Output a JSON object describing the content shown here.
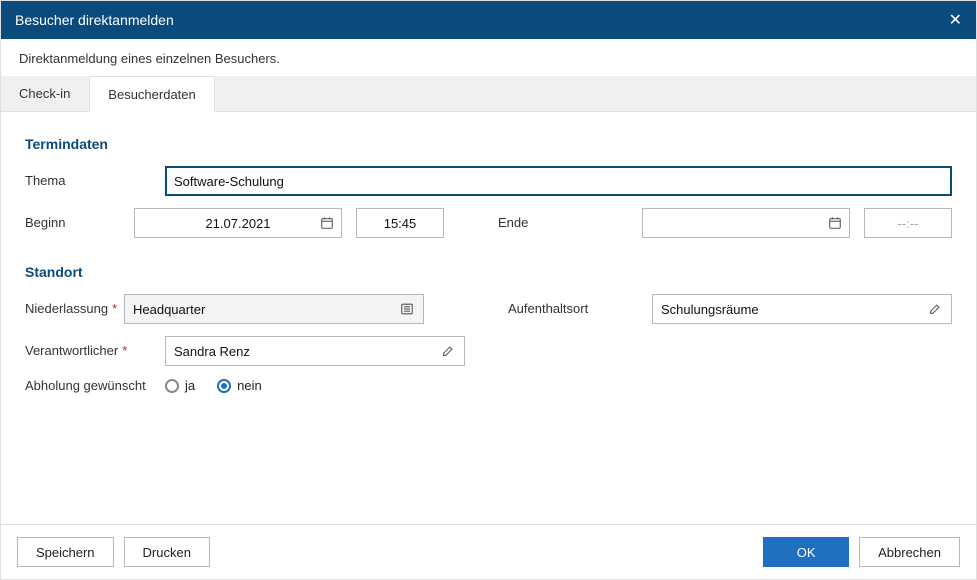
{
  "dialog": {
    "title": "Besucher direktanmelden",
    "subtitle": "Direktanmeldung eines einzelnen Besuchers."
  },
  "tabs": {
    "checkin": "Check-in",
    "besucherdaten": "Besucherdaten"
  },
  "sections": {
    "termindaten": {
      "title": "Termindaten",
      "thema_label": "Thema",
      "thema_value": "Software-Schulung",
      "beginn_label": "Beginn",
      "beginn_date": "21.07.2021",
      "beginn_time": "15:45",
      "ende_label": "Ende",
      "ende_date": "",
      "ende_time_placeholder": "--:--"
    },
    "standort": {
      "title": "Standort",
      "niederlassung_label": "Niederlassung",
      "niederlassung_value": "Headquarter",
      "aufenthaltsort_label": "Aufenthaltsort",
      "aufenthaltsort_value": "Schulungsräume",
      "verantwortlicher_label": "Verantwortlicher",
      "verantwortlicher_value": "Sandra Renz",
      "abholung_label": "Abholung gewünscht",
      "abholung_ja": "ja",
      "abholung_nein": "nein",
      "abholung_selected": "nein"
    }
  },
  "footer": {
    "speichern": "Speichern",
    "drucken": "Drucken",
    "ok": "OK",
    "abbrechen": "Abbrechen"
  }
}
